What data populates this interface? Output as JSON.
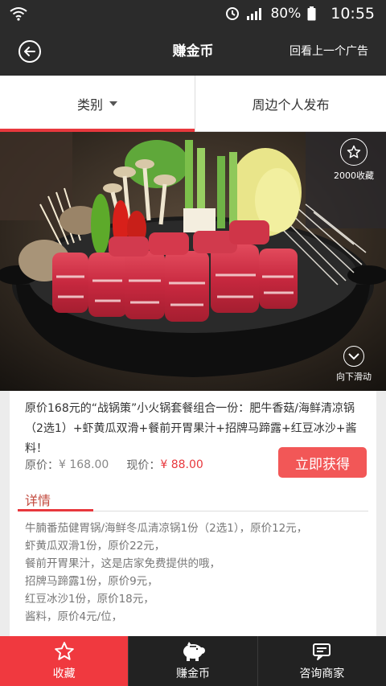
{
  "status_bar": {
    "battery": "80%",
    "time": "10:55"
  },
  "navbar": {
    "title": "赚金币",
    "prev_ad": "回看上一个广告"
  },
  "tabs": {
    "category": "类别",
    "nearby": "周边个人发布"
  },
  "hero": {
    "favorites_count": "2000收藏",
    "scroll_hint": "向下滑动"
  },
  "offer": {
    "description": "原价168元的“战锅策”小火锅套餐组合一份：肥牛香菇/海鲜清凉锅（2选1）+虾黄瓜双滑+餐前开胃果汁+招牌马蹄露+红豆冰沙+酱料！",
    "original_label": "原价：",
    "original_price": "¥ 168.00",
    "current_label": "现价：",
    "current_price": "¥ 88.00",
    "get_button": "立即获得"
  },
  "details": {
    "title": "详情",
    "items": [
      "牛腩番茄健胃锅/海鲜冬瓜清凉锅1份（2选1），原价12元，",
      "虾黄瓜双滑1份，原价22元，",
      "餐前开胃果汁，这是店家免费提供的哦，",
      "招牌马蹄露1份，原价9元，",
      "红豆冰沙1份，原价18元，",
      "酱料，原价4元/位，"
    ]
  },
  "bottom_bar": {
    "favorite": "收藏",
    "earn_coins": "赚金币",
    "consult": "咨询商家"
  },
  "colors": {
    "accent": "#f0393f",
    "dark": "#2b2b2b"
  }
}
